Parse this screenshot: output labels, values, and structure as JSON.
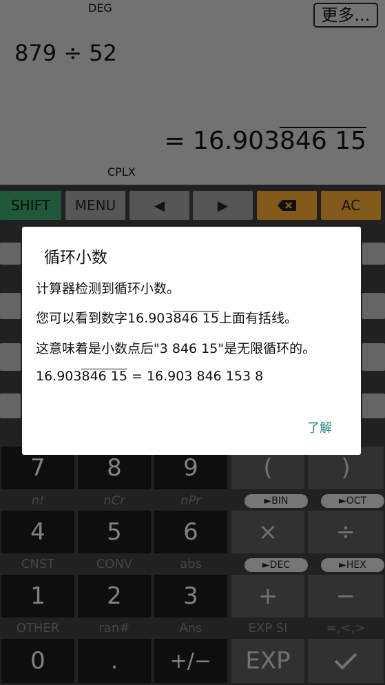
{
  "display": {
    "angle_mode": "DEG",
    "more_button": "更多...",
    "expression": "879 ÷ 52",
    "result_prefix": "= 16.903",
    "result_repeat": " 846 15",
    "complex_mode": "CPLX"
  },
  "top_keys": [
    "SHIFT",
    "MENU",
    "◀",
    "▶",
    "⌫",
    "AC"
  ],
  "rows": [
    {
      "keys": [
        "7",
        "8",
        "9",
        "(",
        ")"
      ]
    },
    {
      "labels": [
        "n!",
        "nCr",
        "nPr"
      ],
      "pills": [
        "►BIN",
        "►OCT"
      ]
    },
    {
      "keys": [
        "4",
        "5",
        "6",
        "×",
        "÷"
      ]
    },
    {
      "labels": [
        "CNST",
        "CONV",
        "abs"
      ],
      "pills": [
        "►DEC",
        "►HEX"
      ]
    },
    {
      "keys": [
        "1",
        "2",
        "3",
        "+",
        "−"
      ]
    },
    {
      "labels": [
        "OTHER",
        "ran#",
        "Ans",
        "EXP SI",
        "=,<,>"
      ]
    },
    {
      "keys": [
        "0",
        ".",
        "+/−",
        "EXP",
        "✓"
      ]
    }
  ],
  "dialog": {
    "title": "循环小数",
    "line1": "计算器检测到循环小数。",
    "line2_pre": "您可以看到数字16.903",
    "line2_ov": " 846 15",
    "line2_post": "上面有括线。",
    "line3": "这意味着是小数点后\"3 846 15\"是无限循环的。",
    "line4_pre": "16.903",
    "line4_ov": " 846 15",
    "line4_post": " = 16.903 846 153 8",
    "ok_button": "了解"
  }
}
